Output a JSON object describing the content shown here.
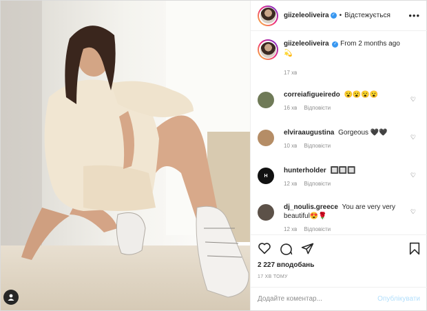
{
  "header": {
    "username": "giizeleoliveira",
    "follow_label": "Відстежується",
    "dot": "•",
    "more": "•••"
  },
  "caption": {
    "username": "giizeleoliveira",
    "text": "From 2 months ago",
    "emoji": "💫",
    "time": "17 хв"
  },
  "comments": [
    {
      "name": "correiafigueiredo",
      "text": "😮😮😮😮",
      "time": "16 хв",
      "reply": "Відповісти",
      "avatar_color": "#6f7a57"
    },
    {
      "name": "elviraaugustina",
      "text": "Gorgeous 🖤🖤",
      "time": "10 хв",
      "reply": "Відповісти",
      "avatar_color": "#b58d66"
    },
    {
      "name": "hunterholder",
      "text": "🔲🔲🔲",
      "time": "12 хв",
      "reply": "Відповісти",
      "avatar_color": "#111111"
    },
    {
      "name": "dj_noulis.greece",
      "text": "You are very very beautiful😍🌹",
      "time": "12 хв",
      "reply": "Відповісти",
      "avatar_color": "#5c5148"
    }
  ],
  "actions": {
    "likes": "2 227 вподобань",
    "ago": "17 ХВ ТОМУ"
  },
  "add_comment": {
    "placeholder": "Додайте коментар...",
    "post_label": "Опублікувати"
  },
  "colors": {
    "accent": "#3897f0",
    "muted": "#8e8e8e",
    "post_disabled": "#b2dffc"
  }
}
